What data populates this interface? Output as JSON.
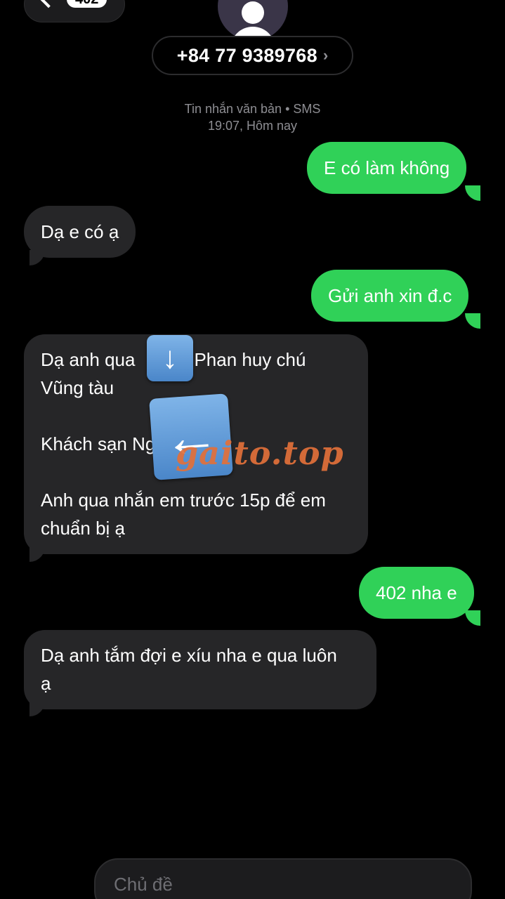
{
  "header": {
    "back_count": "402",
    "phone_number": "+84 77 9389768",
    "chevron": "›"
  },
  "meta": {
    "line1": "Tin nhắn văn bản • SMS",
    "line2": "19:07, Hôm nay"
  },
  "messages": [
    {
      "direction": "out",
      "text": "E có làm không"
    },
    {
      "direction": "in",
      "text": "Dạ e có ạ"
    },
    {
      "direction": "out",
      "text": "Gửi anh xin đ.c"
    },
    {
      "direction": "in",
      "lines": [
        "Dạ anh qua",
        "Phan huy chú",
        "Vũng tàu",
        "",
        "Khách sạn Ng",
        "",
        "Anh qua nhắn em trước 15p để em",
        "chuẩn bị ạ"
      ]
    },
    {
      "direction": "out",
      "text": "402 nha e"
    },
    {
      "direction": "in",
      "lines": [
        "Dạ anh tắm đợi e xíu nha e qua luôn",
        "ạ"
      ]
    }
  ],
  "overlays": {
    "watermark": "gaito.top",
    "sticker_down": "down-arrow-emoji",
    "sticker_left": "left-arrow-emoji"
  },
  "compose": {
    "placeholder": "Chủ đề"
  },
  "colors": {
    "outgoing": "#30d158",
    "incoming": "#262628",
    "background": "#000000"
  }
}
